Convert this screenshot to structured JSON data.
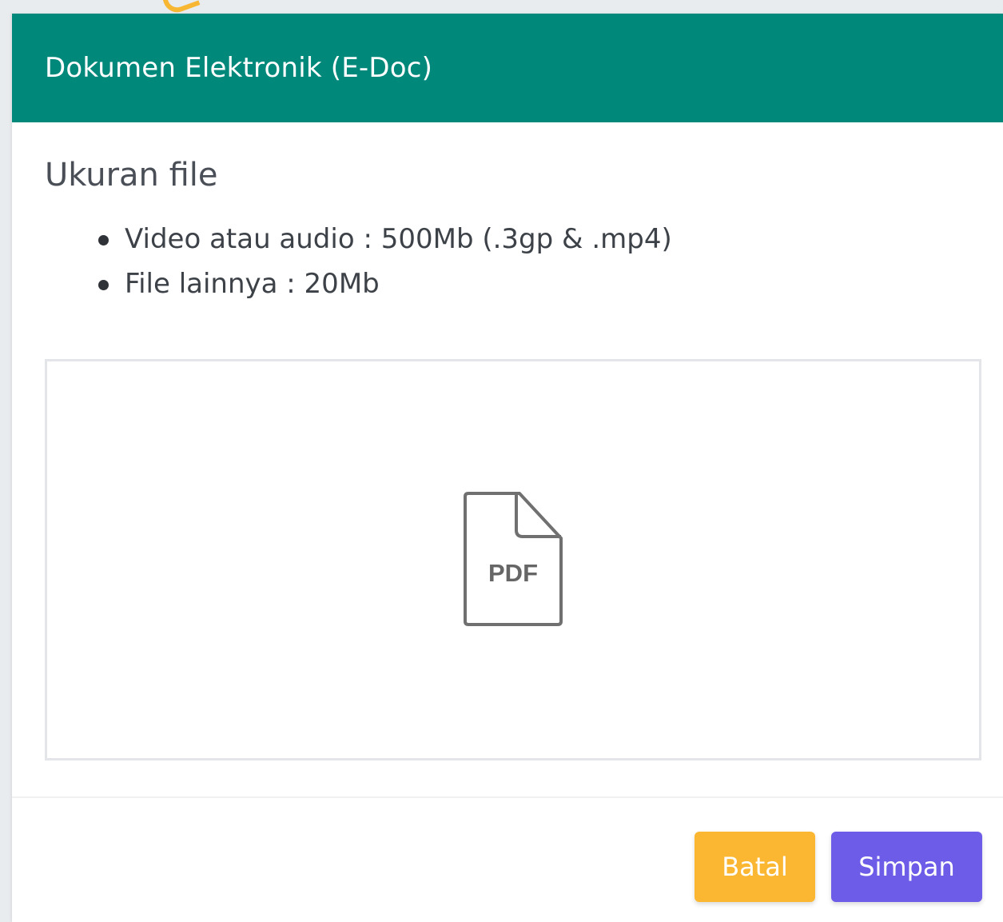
{
  "modal": {
    "title": "Dokumen Elektronik (E-Doc)"
  },
  "body": {
    "heading": "Ukuran file",
    "limits": [
      "Video atau audio : 500Mb (.3gp & .mp4)",
      "File lainnya : 20Mb"
    ]
  },
  "dropzone": {
    "icon": "pdf-file-icon",
    "icon_label": "PDF"
  },
  "footer": {
    "cancel_label": "Batal",
    "save_label": "Simpan"
  },
  "colors": {
    "header": "#00897b",
    "cancel": "#fbb731",
    "save": "#6c5ce7"
  }
}
